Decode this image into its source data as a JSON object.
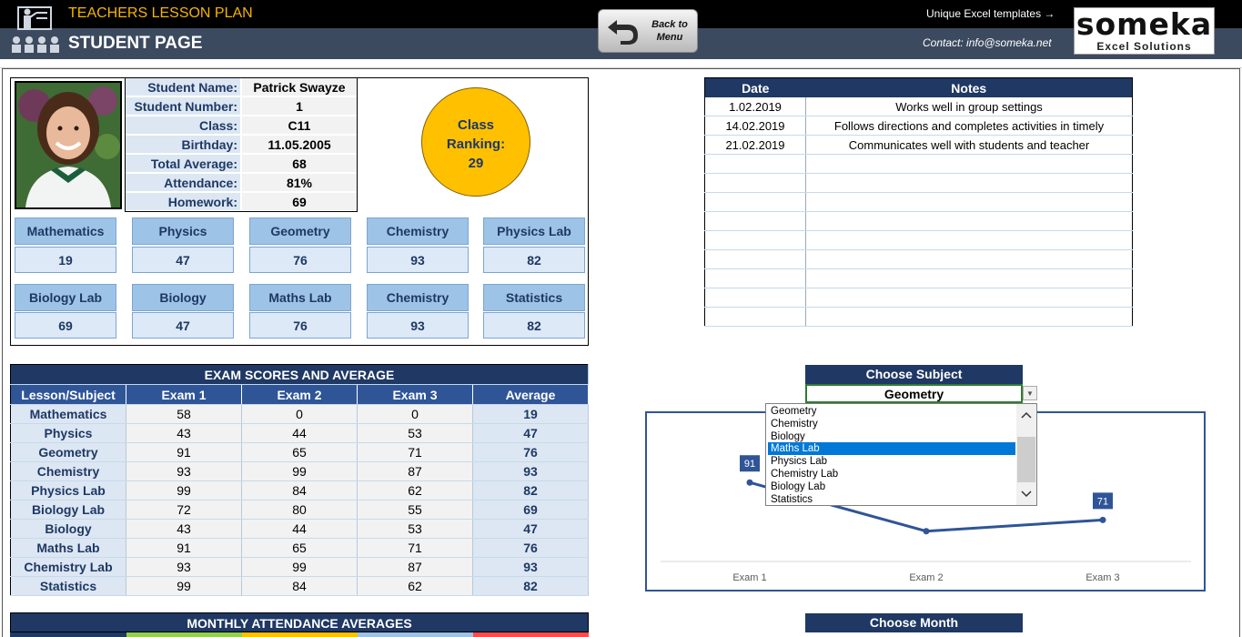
{
  "header": {
    "app_title": "TEACHERS LESSON PLAN",
    "page_title": "STUDENT PAGE",
    "back_button": "Back to Menu",
    "templates_link": "Unique Excel templates →",
    "contact": "Contact: info@someka.net",
    "brand_name": "someka",
    "brand_sub": "Excel Solutions"
  },
  "student": {
    "labels": [
      "Student Name:",
      "Student Number:",
      "Class:",
      "Birthday:",
      "Total Average:",
      "Attendance:",
      "Homework:"
    ],
    "values": [
      "Patrick Swayze",
      "1",
      "C11",
      "11.05.2005",
      "68",
      "81%",
      "69"
    ],
    "ranking_label": "Class Ranking:",
    "ranking_value": "29"
  },
  "cards": [
    {
      "subject": "Mathematics",
      "score": "19"
    },
    {
      "subject": "Physics",
      "score": "47"
    },
    {
      "subject": "Geometry",
      "score": "76"
    },
    {
      "subject": "Chemistry",
      "score": "93"
    },
    {
      "subject": "Physics Lab",
      "score": "82"
    },
    {
      "subject": "Biology Lab",
      "score": "69"
    },
    {
      "subject": "Biology",
      "score": "47"
    },
    {
      "subject": "Maths Lab",
      "score": "76"
    },
    {
      "subject": "Chemistry",
      "score": "93"
    },
    {
      "subject": "Statistics",
      "score": "82"
    }
  ],
  "notes": {
    "headers": [
      "Date",
      "Notes"
    ],
    "rows": [
      [
        "1.02.2019",
        "Works well in group settings"
      ],
      [
        "14.02.2019",
        "Follows directions and completes activities in timely"
      ],
      [
        "21.02.2019",
        "Communicates well with students and teacher"
      ]
    ]
  },
  "exam": {
    "title": "EXAM SCORES AND AVERAGE",
    "headers": [
      "Lesson/Subject",
      "Exam 1",
      "Exam 2",
      "Exam 3",
      "Average"
    ],
    "rows": [
      [
        "Mathematics",
        "58",
        "0",
        "0",
        "19"
      ],
      [
        "Physics",
        "43",
        "44",
        "53",
        "47"
      ],
      [
        "Geometry",
        "91",
        "65",
        "71",
        "76"
      ],
      [
        "Chemistry",
        "93",
        "99",
        "87",
        "93"
      ],
      [
        "Physics Lab",
        "99",
        "84",
        "62",
        "82"
      ],
      [
        "Biology Lab",
        "72",
        "80",
        "55",
        "69"
      ],
      [
        "Biology",
        "43",
        "44",
        "53",
        "47"
      ],
      [
        "Maths Lab",
        "91",
        "65",
        "71",
        "76"
      ],
      [
        "Chemistry Lab",
        "93",
        "99",
        "87",
        "93"
      ],
      [
        "Statistics",
        "99",
        "84",
        "62",
        "82"
      ]
    ]
  },
  "attendance": {
    "title": "MONTHLY ATTENDANCE AVERAGES",
    "strip_colors": [
      "#1f3864",
      "#92d050",
      "#ffc000",
      "#9dc3e6",
      "#ff4b4b"
    ]
  },
  "choose_subject": {
    "title": "Choose Subject",
    "selected": "Geometry",
    "options": [
      "Geometry",
      "Chemistry",
      "Biology",
      "Maths Lab",
      "Physics Lab",
      "Chemistry Lab",
      "Biology Lab",
      "Statistics"
    ],
    "highlighted": "Maths Lab"
  },
  "choose_month": {
    "title": "Choose Month"
  },
  "chart_data": {
    "type": "line",
    "categories": [
      "Exam 1",
      "Exam 2",
      "Exam 3"
    ],
    "series": [
      {
        "values": [
          91,
          65,
          71
        ],
        "color": "#2f5597"
      }
    ],
    "data_labels_visible": [
      "91",
      "71"
    ]
  }
}
